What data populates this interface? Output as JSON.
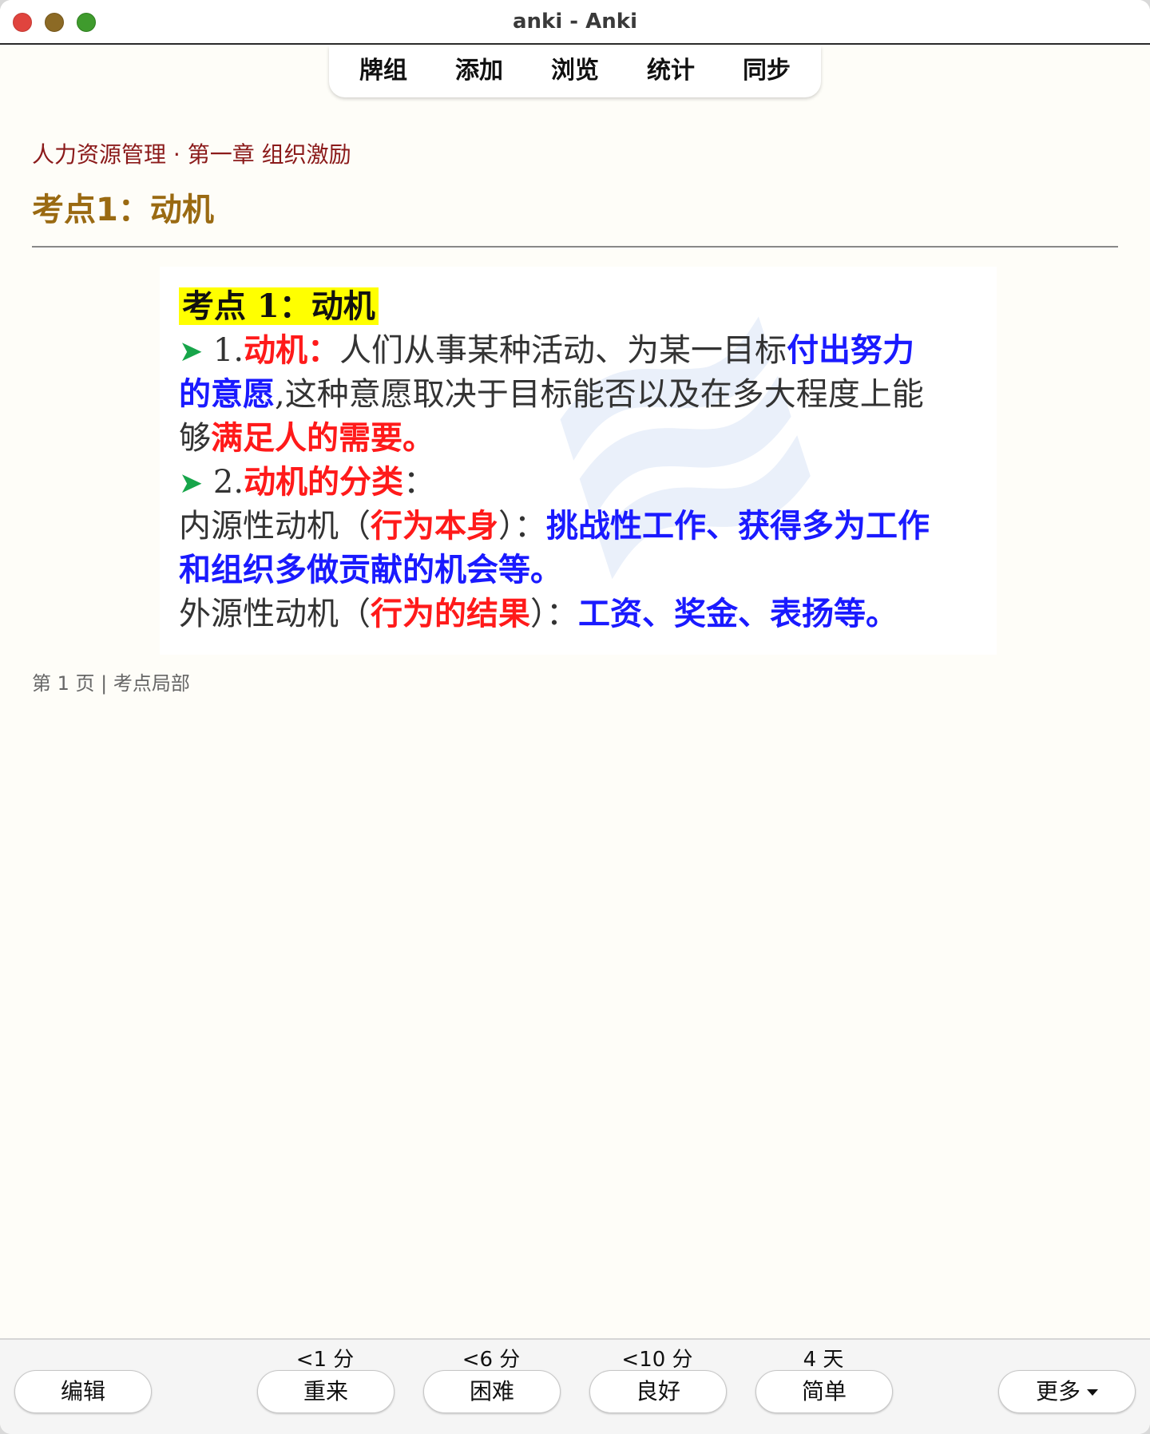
{
  "window": {
    "title": "anki - Anki"
  },
  "toolbar": {
    "items": [
      "牌组",
      "添加",
      "浏览",
      "统计",
      "同步"
    ]
  },
  "card": {
    "deck_path": "人力资源管理 · 第一章 组织激励",
    "title": "考点1：动机",
    "footer": "第 1 页 | 考点局部",
    "image": {
      "line1_highlight": "考点 1：动机",
      "line2_arrow": "➤",
      "line2_num": " 1.",
      "line2_red": "动机：",
      "line2_text": "人们从事某种活动、为某一目标",
      "line2_blue": "付出努力",
      "line3_blue": "的意愿",
      "line3_text": ",这种意愿取决于目标能否以及在多大程度上能",
      "line4_text": "够",
      "line4_red": "满足人的需要。",
      "line5_arrow": "➤",
      "line5_num": " 2.",
      "line5_red": "动机的分类",
      "line5_text": "：",
      "line6_text1": "内源性动机（",
      "line6_red": "行为本身",
      "line6_text2": "）：",
      "line6_blue": "挑战性工作、获得多为工作",
      "line7_blue": "和组织多做贡献的机会等。",
      "line8_text1": "外源性动机（",
      "line8_red": "行为的结果",
      "line8_text2": "）：",
      "line8_blue": "工资、奖金、表扬等。"
    }
  },
  "answer_bar": {
    "edit_label": "编辑",
    "more_label": "更多",
    "ease": [
      {
        "time": "<1 分",
        "label": "重来"
      },
      {
        "time": "<6 分",
        "label": "困难"
      },
      {
        "time": "<10 分",
        "label": "良好"
      },
      {
        "time": "4 天",
        "label": "简单"
      }
    ]
  }
}
